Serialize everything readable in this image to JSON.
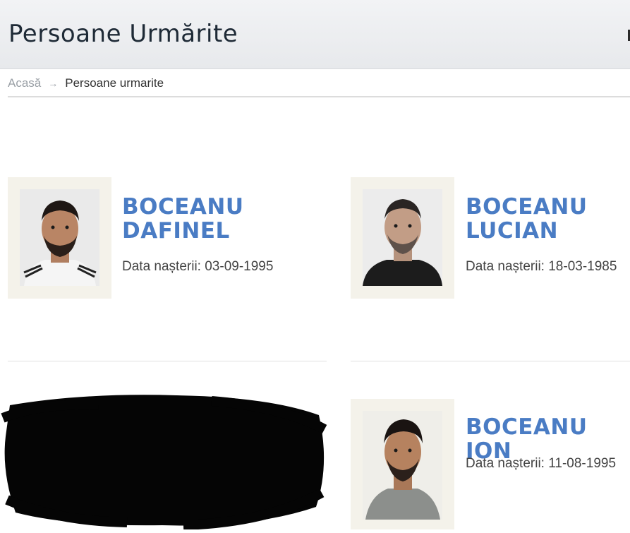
{
  "page": {
    "title": "Persoane Urmărite"
  },
  "breadcrumb": {
    "home": "Acasă",
    "arrow": "→",
    "current": "Persoane urmarite"
  },
  "persons": [
    {
      "name_line1": "BOCEANU",
      "name_line2": "DAFINEL",
      "birth_label": "Data nașterii:",
      "birth_date": "03-09-1995"
    },
    {
      "name_line1": "BOCEANU",
      "name_line2": "LUCIAN",
      "birth_label": "Data nașterii:",
      "birth_date": "18-03-1985"
    },
    {
      "name_line1": "BOCEANU ION",
      "birth_label": "Data nașterii:",
      "birth_date": "11-08-1995"
    }
  ],
  "colors": {
    "accent": "#4a7cc4",
    "header_bg": "#eceef0",
    "redaction": "#050505"
  }
}
